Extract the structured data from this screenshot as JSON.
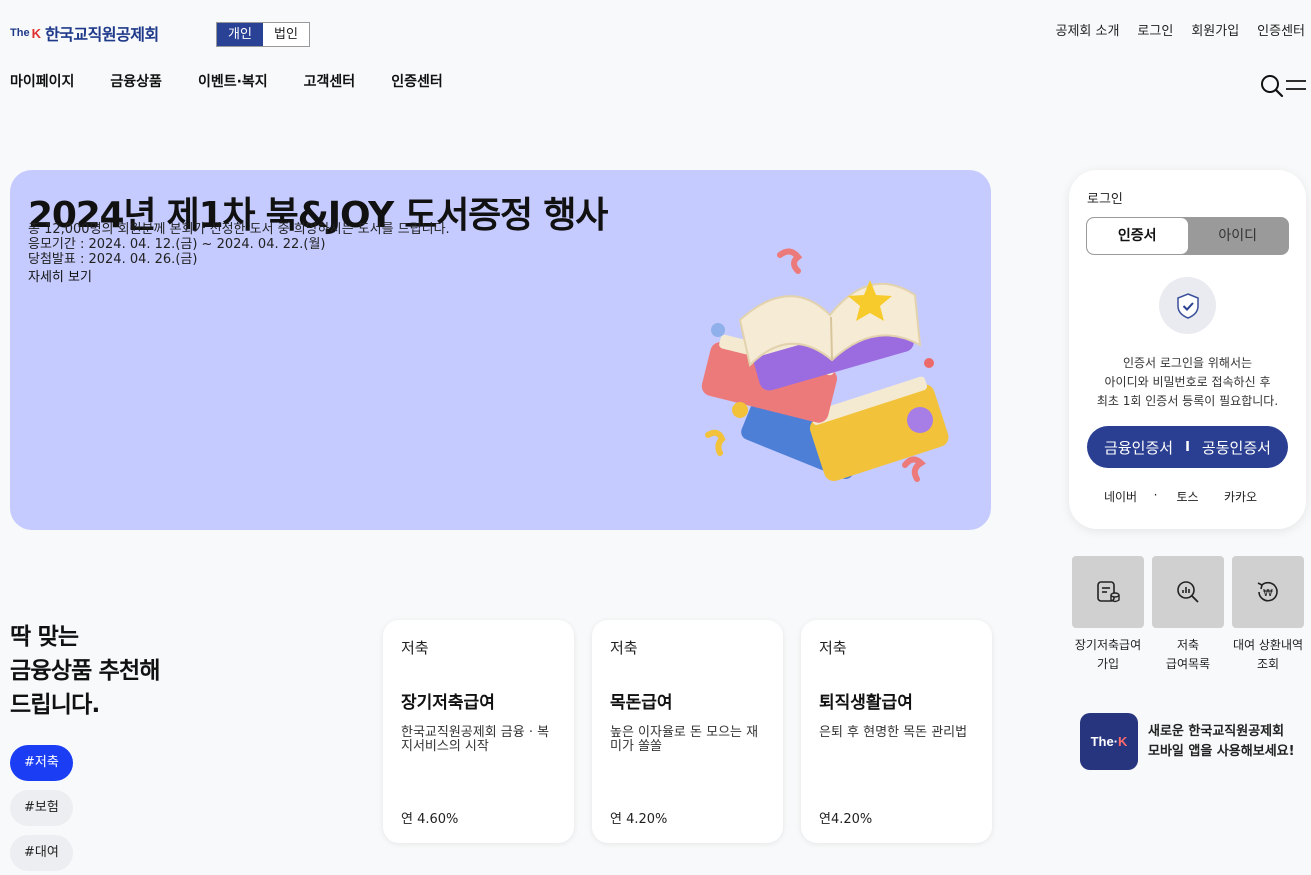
{
  "header": {
    "logo": {
      "the": "The",
      "k": "K",
      "name": "한국교직원공제회"
    },
    "segments": [
      "개인",
      "법인"
    ],
    "top_links": [
      "공제회 소개",
      "로그인",
      "회원가입",
      "인증센터"
    ],
    "gnb": [
      "마이페이지",
      "금융상품",
      "이벤트·복지",
      "고객센터",
      "인증센터"
    ]
  },
  "hero": {
    "title": "2024년 제1차 북&JOY 도서증정 행사",
    "line1": "총 12,000명의 회원분께 본회가 선정한 도서 중 희망하시는 도서를 드립니다.",
    "line2": "응모기간 : 2024. 04. 12.(금) ~ 2024. 04. 22.(월)",
    "line3": "당첨발표 : 2024. 04. 26.(금)",
    "more": "자세히 보기"
  },
  "login": {
    "title": "로그인",
    "tabs": [
      "인증서",
      "아이디"
    ],
    "desc1": "인증서 로그인을 위해서는",
    "desc2": "아이디와 비밀번호로 접속하신 후",
    "desc3": "최초 1회 인증서 등록이 필요합니다.",
    "btn_left": "금융인증서",
    "btn_sep": "I",
    "btn_right": "공동인증서",
    "alt": [
      "네이버",
      "·",
      "토스",
      "카카오"
    ]
  },
  "quick": [
    {
      "label": "장기저축급여\n가입",
      "icon": "document-coin-icon"
    },
    {
      "label": "저축\n급여목록",
      "icon": "magnify-chart-icon"
    },
    {
      "label": "대여 상환내역\n조회",
      "icon": "won-refresh-icon"
    }
  ],
  "app": {
    "icon_the": "The·",
    "icon_k": "K",
    "text": "새로운 한국교직원공제회\n모바일 앱을 사용해보세요!"
  },
  "recommend": {
    "title": "딱 맞는\n금융상품 추천해\n드립니다.",
    "chips": [
      "#저축",
      "#보험",
      "#대여"
    ],
    "cards": [
      {
        "category": "저축",
        "name": "장기저축급여",
        "desc": "한국교직원공제회 금융 · 복지서비스의 시작",
        "rate": "연 4.60%"
      },
      {
        "category": "저축",
        "name": "목돈급여",
        "desc": "높은 이자율로 돈 모으는 재미가 쏠쏠",
        "rate": "연 4.20%"
      },
      {
        "category": "저축",
        "name": "퇴직생활급여",
        "desc": "은퇴 후 현명한 목돈 관리법",
        "rate": "연4.20%"
      }
    ]
  },
  "colors": {
    "brand": "#2a4296",
    "hero_bg": "#c5cbff",
    "chip_active": "#1b3ef5"
  }
}
